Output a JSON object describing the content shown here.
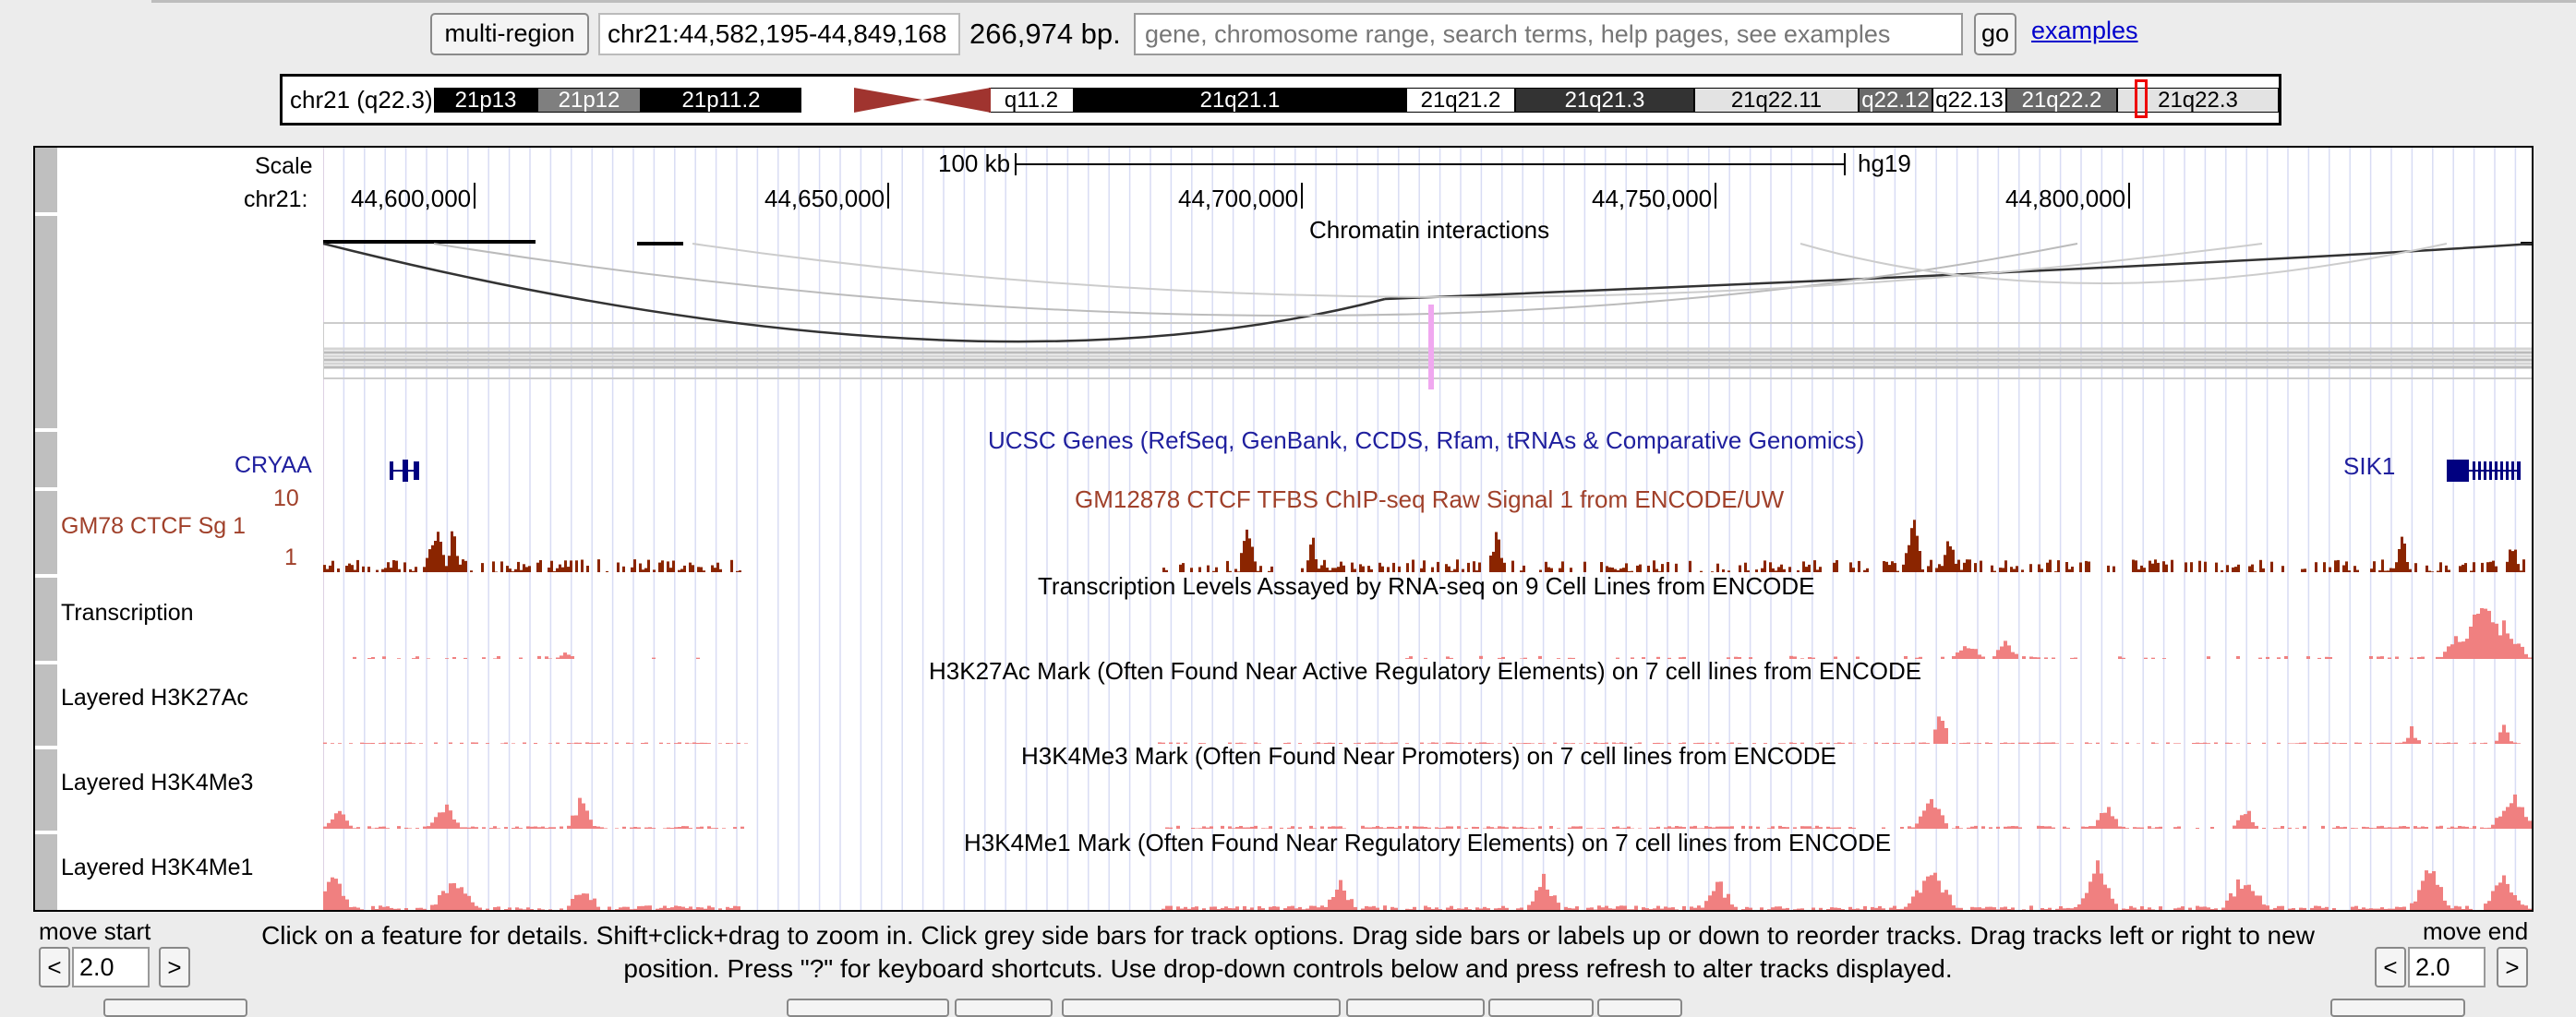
{
  "toolbar": {
    "multiregion_label": "multi-region",
    "position": "chr21:44,582,195-44,849,168",
    "region_size": "266,974 bp.",
    "search_placeholder": "gene, chromosome range, search terms, help pages, see examples",
    "go_label": "go",
    "examples_label": "examples"
  },
  "ideogram": {
    "label": "chr21 (q22.3)",
    "bands": [
      {
        "name": "21p13",
        "shade": "black"
      },
      {
        "name": "21p12",
        "shade": "gray"
      },
      {
        "name": "21p11.2",
        "shade": "black"
      },
      {
        "name": "q11.2",
        "shade": "white"
      },
      {
        "name": "21q21.1",
        "shade": "black"
      },
      {
        "name": "21q21.2",
        "shade": "white"
      },
      {
        "name": "21q21.3",
        "shade": "dark"
      },
      {
        "name": "21q22.11",
        "shade": "light"
      },
      {
        "name": "q22.12",
        "shade": "mid"
      },
      {
        "name": "q22.13",
        "shade": "white"
      },
      {
        "name": "21q22.2",
        "shade": "mid"
      },
      {
        "name": "21q22.3",
        "shade": "light"
      }
    ],
    "centromere_color": "#a0342f",
    "highlight_color": "#ee0000"
  },
  "ruler": {
    "scale_label": "Scale",
    "chrom_label": "chr21:",
    "scale_bar_label": "100 kb",
    "assembly": "hg19",
    "ticks": [
      "44,600,000",
      "44,650,000",
      "44,700,000",
      "44,750,000",
      "44,800,000"
    ]
  },
  "tracks": {
    "interactions_title": "Chromatin interactions",
    "genes_title": "UCSC Genes (RefSeq, GenBank, CCDS, Rfam, tRNAs & Comparative Genomics)",
    "gene_left": "CRYAA",
    "gene_right": "SIK1",
    "ctcf_label": "GM78 CTCF Sg 1",
    "ctcf_title": "GM12878 CTCF TFBS ChIP-seq Raw Signal 1 from ENCODE/UW",
    "ctcf_ymax": "10",
    "ctcf_ymin": "1",
    "transcription_label": "Transcription",
    "transcription_title": "Transcription Levels Assayed by RNA-seq on 9 Cell Lines from ENCODE",
    "h3k27ac_label": "Layered H3K27Ac",
    "h3k27ac_title": "H3K27Ac Mark (Often Found Near Active Regulatory Elements) on 7 cell lines from ENCODE",
    "h3k4me3_label": "Layered H3K4Me3",
    "h3k4me3_title": "H3K4Me3 Mark (Often Found Near Promoters) on 7 cell lines from ENCODE",
    "h3k4me1_label": "Layered H3K4Me1",
    "h3k4me1_title": "H3K4Me1 Mark (Often Found Near Regulatory Elements) on 7 cell lines from ENCODE"
  },
  "colors": {
    "gene": "#000080",
    "ctcf": "#8b2500",
    "histone": "#f08080",
    "title_blue": "#1f1f9e",
    "ctcf_title": "#a0402a"
  },
  "hint": "Click on a feature for details. Shift+click+drag to zoom in. Click grey side bars for track options. Drag side bars or labels up or down to reorder tracks. Drag tracks left or right to new position. Press \"?\" for keyboard shortcuts. Use drop-down controls below and press refresh to alter tracks displayed.",
  "move_start": {
    "label": "move start",
    "value": "2.0",
    "left": "<",
    "right": ">"
  },
  "move_end": {
    "label": "move end",
    "value": "2.0",
    "left": "<",
    "right": ">"
  }
}
